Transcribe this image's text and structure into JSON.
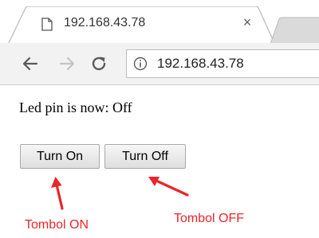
{
  "browser": {
    "tab": {
      "title": "192.168.43.78",
      "close_glyph": "×"
    },
    "toolbar": {
      "url": "192.168.43.78",
      "back_icon": "back-arrow-icon",
      "forward_icon": "forward-arrow-icon",
      "reload_icon": "reload-icon",
      "info_icon": "info-icon"
    }
  },
  "page": {
    "status_text": "Led pin is now: Off",
    "buttons": {
      "turn_on": "Turn On",
      "turn_off": "Turn Off"
    }
  },
  "annotations": {
    "label_on": "Tombol ON",
    "label_off": "Tombol OFF",
    "color": "#e8262a"
  }
}
